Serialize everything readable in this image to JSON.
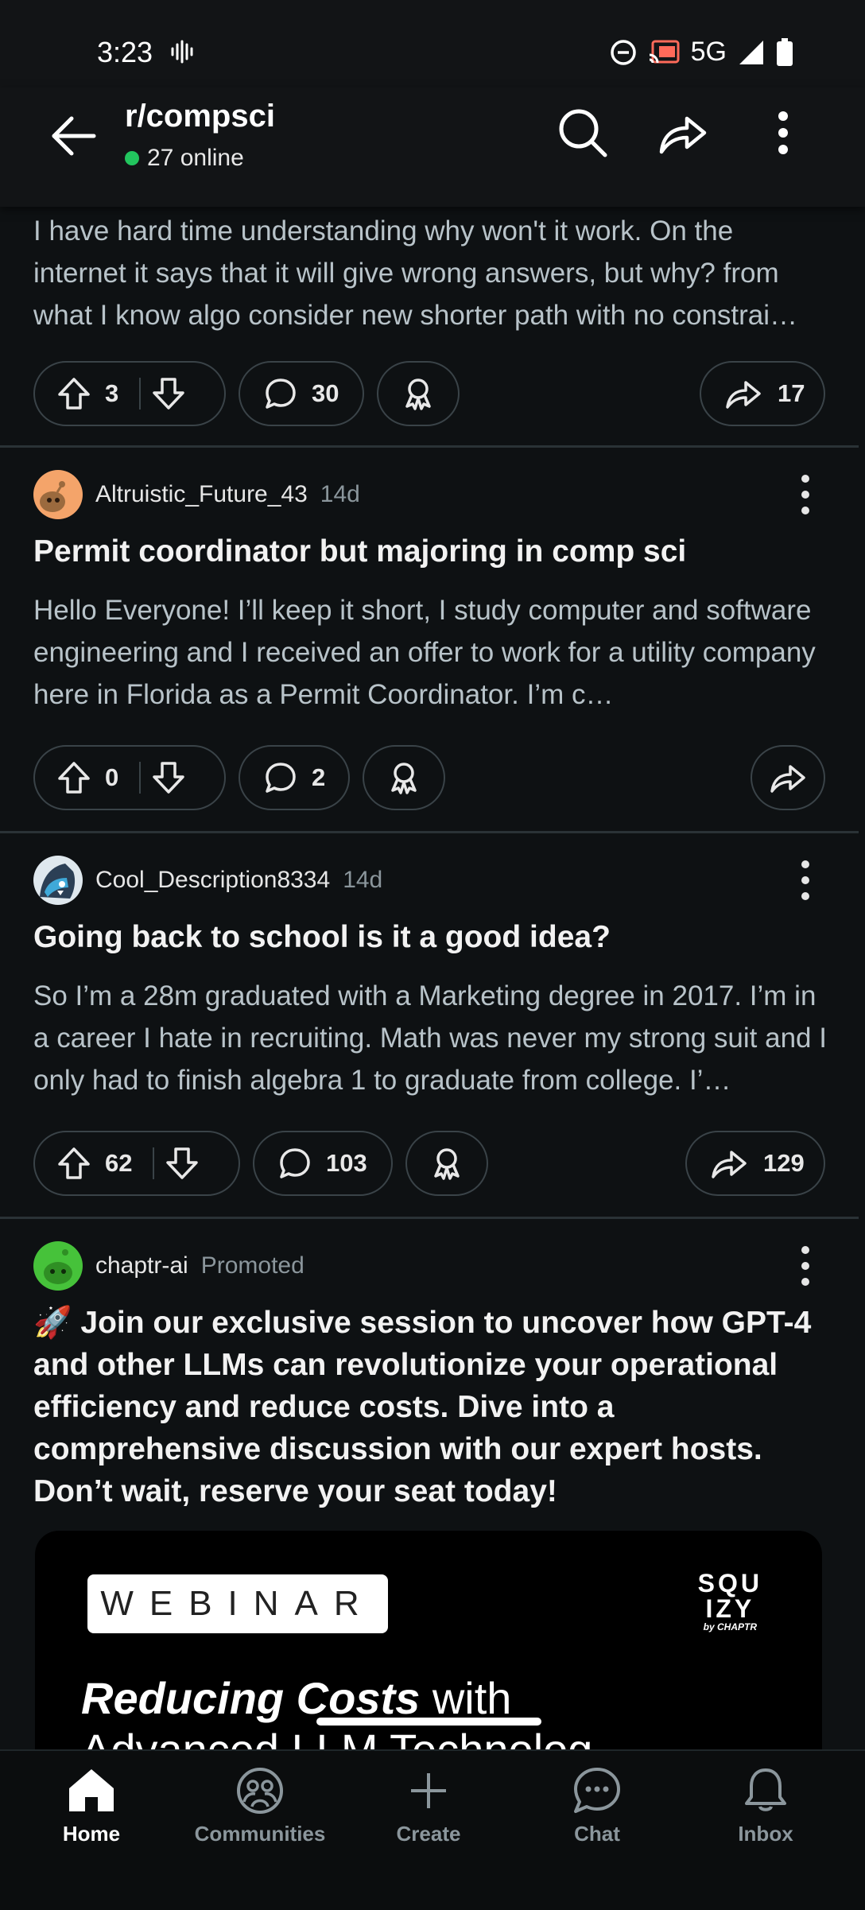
{
  "status": {
    "time": "3:23",
    "network": "5G"
  },
  "header": {
    "title": "r/compsci",
    "online": "27 online"
  },
  "posts": [
    {
      "body": "I have hard time understanding why won't it work. On the internet it says that it will give wrong answers, but why? from what I know algo consider new shorter path with no constrai…",
      "upvotes": "3",
      "comments": "30",
      "shares": "17"
    },
    {
      "author": "Altruistic_Future_43",
      "age": "14d",
      "title": "Permit coordinator but majoring in comp sci",
      "body": "Hello Everyone! I’ll keep it short, I study computer and software engineering and I received an offer to work for a utility company here in Florida as a Permit Coordinator. I’m c…",
      "upvotes": "0",
      "comments": "2"
    },
    {
      "author": "Cool_Description8334",
      "age": "14d",
      "title": "Going back to school is it a good idea?",
      "body": "So I’m a 28m graduated with a Marketing degree in 2017. I’m in a career I hate in recruiting. Math was never my strong suit and I only had to finish algebra 1 to graduate from college. I’…",
      "upvotes": "62",
      "comments": "103",
      "shares": "129"
    }
  ],
  "promo": {
    "author": "chaptr-ai",
    "label": "Promoted",
    "emoji": "🚀",
    "title": "Join our exclusive session to uncover how GPT-4 and other LLMs can revolutionize your operational efficiency and reduce costs. Dive into a comprehensive discussion with our expert hosts. Don’t wait, reserve your seat today!",
    "image": {
      "badge": "WEBINAR",
      "brand_line1": "SQU",
      "brand_line2": "IZY",
      "brand_sub": "by CHAPTR",
      "headline_bold": "Reducing Costs",
      "headline_rest": " with",
      "headline_line2": "Advanced LLM Technolog"
    }
  },
  "nav": [
    {
      "label": "Home",
      "icon": "home-icon",
      "active": true
    },
    {
      "label": "Communities",
      "icon": "communities-icon"
    },
    {
      "label": "Create",
      "icon": "plus-icon"
    },
    {
      "label": "Chat",
      "icon": "chat-icon"
    },
    {
      "label": "Inbox",
      "icon": "bell-icon"
    }
  ]
}
